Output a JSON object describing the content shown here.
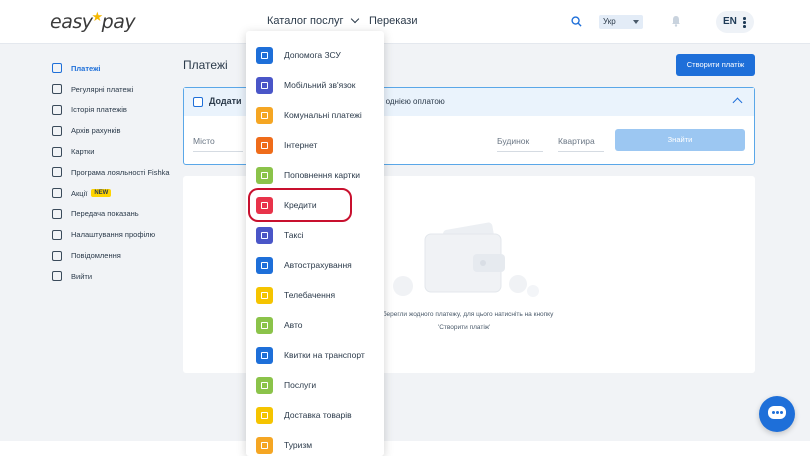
{
  "header": {
    "logo": {
      "left": "easy",
      "right": "pay"
    },
    "nav_catalog": "Каталог послуг",
    "nav_transfers": "Перекази",
    "lang_select": "Укр",
    "user_lang": "EN"
  },
  "sidebar": {
    "items": [
      {
        "label": "Платежі",
        "icon": "payments-icon",
        "active": true
      },
      {
        "label": "Регулярні платежі",
        "icon": "clock-icon"
      },
      {
        "label": "Історія платежів",
        "icon": "history-icon"
      },
      {
        "label": "Архів рахунків",
        "icon": "archive-icon"
      },
      {
        "label": "Картки",
        "icon": "card-icon"
      },
      {
        "label": "Програма лояльності Fishka",
        "icon": "loyalty-icon"
      },
      {
        "label": "Акції",
        "icon": "promo-icon",
        "badge": "NEW"
      },
      {
        "label": "Передача показань",
        "icon": "meter-icon"
      },
      {
        "label": "Налаштування профілю",
        "icon": "gear-icon"
      },
      {
        "label": "Повідомлення",
        "icon": "bell-icon"
      },
      {
        "label": "Вийти",
        "icon": "logout-icon"
      }
    ]
  },
  "main": {
    "title": "Платежі",
    "create_button": "Створити платіж",
    "add_box": {
      "title_left": "Додати",
      "title_right": "нки однією оплатою",
      "field_city": "Місто",
      "field_house": "Будинок",
      "field_apartment": "Квартира",
      "find_button": "Знайти"
    },
    "empty": {
      "line1": "зберегли жодного платежу, для цього натисніть на кнопку",
      "line2": "'Створити платіж'"
    }
  },
  "dropdown": {
    "items": [
      {
        "label": "Допомога ЗСУ",
        "color": "#1e6fd9"
      },
      {
        "label": "Мобільний зв'язок",
        "color": "#4a56c8"
      },
      {
        "label": "Комунальні платежі",
        "color": "#f5a623"
      },
      {
        "label": "Інтернет",
        "color": "#ef6c1a"
      },
      {
        "label": "Поповнення картки",
        "color": "#8bc34a"
      },
      {
        "label": "Кредити",
        "color": "#e8334a"
      },
      {
        "label": "Таксі",
        "color": "#4a56c8"
      },
      {
        "label": "Автострахування",
        "color": "#1e6fd9"
      },
      {
        "label": "Телебачення",
        "color": "#f5c400"
      },
      {
        "label": "Авто",
        "color": "#8bc34a"
      },
      {
        "label": "Квитки на транспорт",
        "color": "#1e6fd9"
      },
      {
        "label": "Послуги",
        "color": "#8bc34a"
      },
      {
        "label": "Доставка товарів",
        "color": "#f5c400"
      },
      {
        "label": "Туризм",
        "color": "#f5a623"
      }
    ]
  }
}
